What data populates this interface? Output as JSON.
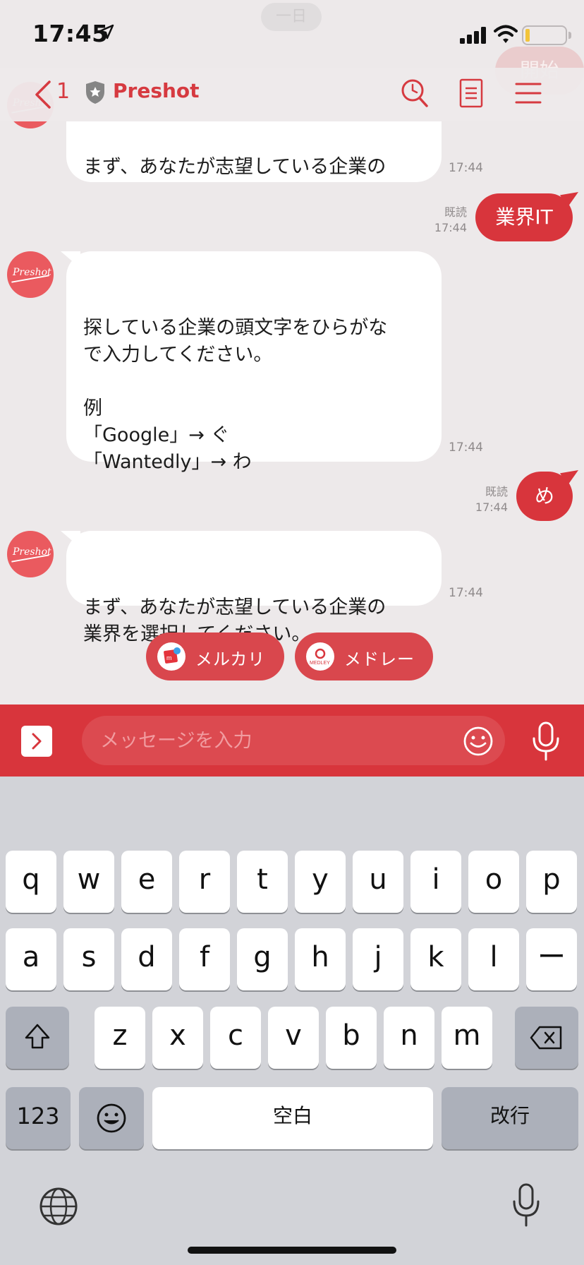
{
  "status_bar": {
    "time": "17:45"
  },
  "ghost": {
    "date": "一日",
    "start_bubble": "開始"
  },
  "nav": {
    "back_count": "1",
    "title": "Preshot"
  },
  "avatar": {
    "logo_text": "Preshot"
  },
  "messages": [
    {
      "id": "m1",
      "text": "まず、あなたが志望している企業の\n業界を選択してください。",
      "time": "17:44"
    },
    {
      "id": "m2",
      "text": "業界IT",
      "time": "17:44",
      "read": "既読"
    },
    {
      "id": "m3",
      "text": "探している企業の頭文字をひらがな\nで入力してください。\n\n例\n「Google」→ ぐ\n「Wantedly」→ わ\n",
      "time": "17:44"
    },
    {
      "id": "m4",
      "text": "め",
      "time": "17:44",
      "read": "既読"
    },
    {
      "id": "m5",
      "text": "まず、あなたが志望している企業の\n業界を選択してください。",
      "time": "17:44"
    }
  ],
  "quick_replies": [
    {
      "label": "メルカリ",
      "icon": "mercari-logo-icon"
    },
    {
      "label": "メドレー",
      "icon": "medley-logo-icon",
      "icon_text": "MEDLEY"
    }
  ],
  "input": {
    "placeholder": "メッセージを入力"
  },
  "keyboard": {
    "row1": [
      "q",
      "w",
      "e",
      "r",
      "t",
      "y",
      "u",
      "i",
      "o",
      "p"
    ],
    "row2": [
      "a",
      "s",
      "d",
      "f",
      "g",
      "h",
      "j",
      "k",
      "l",
      "ー"
    ],
    "row3": [
      "z",
      "x",
      "c",
      "v",
      "b",
      "n",
      "m"
    ],
    "numbers_key": "123",
    "space_key": "空白",
    "return_key": "改行"
  },
  "colors": {
    "accent": "#d8353c",
    "background": "#ede9ea",
    "keyboard": "#d2d3d8"
  }
}
